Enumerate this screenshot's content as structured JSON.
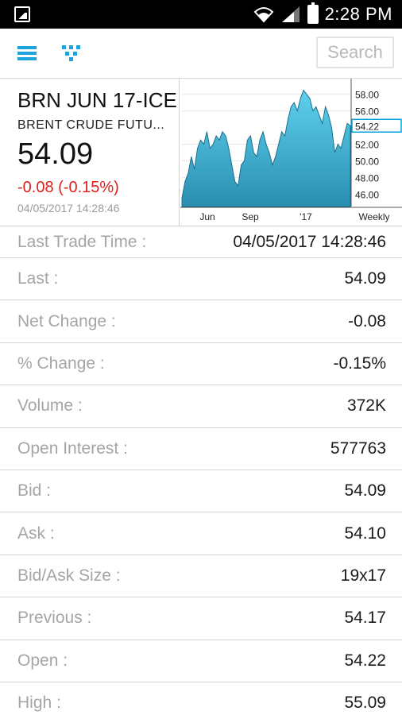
{
  "status_bar": {
    "time": "2:28 PM"
  },
  "toolbar": {
    "search_placeholder": "Search"
  },
  "quote": {
    "symbol": "BRN JUN 17-ICE",
    "name": "BRENT CRUDE FUTU...",
    "price": "54.09",
    "change": "-0.08 (-0.15%)",
    "timestamp": "04/05/2017 14:28:46",
    "change_color": "#e0201b"
  },
  "chart_data": {
    "type": "area",
    "title": "",
    "xlabel": "",
    "ylabel": "",
    "x_tick_labels": [
      "Jun",
      "Sep",
      "'17"
    ],
    "period_label": "Weekly",
    "y_ticks": [
      "58.00",
      "56.00",
      "54.22",
      "52.00",
      "50.00",
      "48.00",
      "46.00"
    ],
    "current_value_label": "54.22",
    "ylim": [
      44.5,
      59.5
    ],
    "grid": true,
    "series": [
      {
        "values": [
          45.5,
          47.5,
          48.5,
          50.5,
          49.0,
          51.5,
          52.5,
          52.0,
          53.5,
          51.5,
          52.0,
          53.0,
          52.5,
          53.5,
          53.0,
          51.5,
          49.5,
          47.5,
          47.0,
          49.5,
          50.0,
          52.5,
          53.0,
          51.0,
          50.5,
          52.5,
          53.5,
          52.0,
          51.0,
          49.5,
          50.5,
          52.0,
          53.5,
          53.0,
          55.0,
          56.5,
          57.0,
          56.0,
          57.5,
          58.5,
          58.0,
          57.5,
          56.0,
          56.5,
          55.5,
          54.5,
          56.5,
          55.5,
          54.0,
          51.0,
          52.0,
          51.5,
          53.0,
          54.5,
          54.2
        ]
      }
    ],
    "fill_color": "#2a8eb0",
    "label_bg": "#ffffff",
    "highlight_color": "#00a3e0"
  },
  "details": [
    {
      "label": "Last Trade Time :",
      "value": "04/05/2017 14:28:46"
    },
    {
      "label": "Last :",
      "value": "54.09"
    },
    {
      "label": "Net Change :",
      "value": "-0.08"
    },
    {
      "label": "% Change :",
      "value": "-0.15%"
    },
    {
      "label": "Volume :",
      "value": "372K"
    },
    {
      "label": "Open Interest :",
      "value": "577763"
    },
    {
      "label": "Bid :",
      "value": "54.09"
    },
    {
      "label": "Ask :",
      "value": "54.10"
    },
    {
      "label": "Bid/Ask Size :",
      "value": "19x17"
    },
    {
      "label": "Previous :",
      "value": "54.17"
    },
    {
      "label": "Open :",
      "value": "54.22"
    },
    {
      "label": "High :",
      "value": "55.09"
    }
  ]
}
